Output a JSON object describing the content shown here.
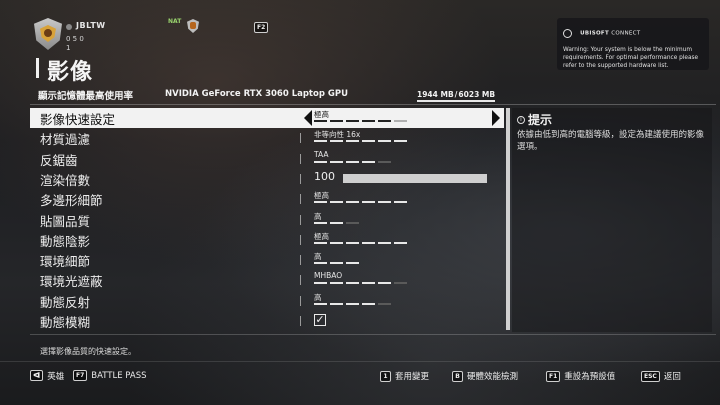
{
  "player": {
    "name": "JBLTW",
    "stats": "0 5 0",
    "rank": "1"
  },
  "header_extra": {
    "nat_label": "NAT",
    "f2_key": "F2"
  },
  "ubisoft": {
    "brand": "UBISOFT",
    "suffix": "CONNECT",
    "message": "Warning: Your system is below the minimum requirements. For optimal performance please refer to the supported hardware list."
  },
  "page": {
    "title": "影像"
  },
  "vram": {
    "label": "顯示記憶體最高使用率",
    "gpu": "NVIDIA GeForce RTX 3060 Laptop GPU",
    "used": "1944 MB",
    "total": "6023 MB",
    "used_fraction": 0.32
  },
  "settings": [
    {
      "label": "影像快速設定",
      "value": "極高",
      "level": 5,
      "total": 6,
      "selected": true
    },
    {
      "label": "材質過濾",
      "value": "非等向性 16x",
      "level": 6,
      "total": 6
    },
    {
      "label": "反鋸齒",
      "value": "TAA",
      "level": 4,
      "total": 5
    },
    {
      "label": "渲染倍數",
      "value": "100",
      "type": "slider",
      "fraction": 1.0
    },
    {
      "label": "多邊形細節",
      "value": "極高",
      "level": 6,
      "total": 6
    },
    {
      "label": "貼圖品質",
      "value": "高",
      "level": 2,
      "total": 3
    },
    {
      "label": "動態陰影",
      "value": "極高",
      "level": 6,
      "total": 6
    },
    {
      "label": "環境細節",
      "value": "高",
      "level": 3,
      "total": 3
    },
    {
      "label": "環境光遮蔽",
      "value": "MHBAO",
      "level": 5,
      "total": 6
    },
    {
      "label": "動態反射",
      "value": "高",
      "level": 4,
      "total": 5
    },
    {
      "label": "動態模糊",
      "type": "checkbox",
      "checked": true,
      "check_glyph": "✓"
    }
  ],
  "hint": {
    "icon": "i",
    "title": "提示",
    "text": "依據由低到高的電腦等級，設定為建議使用的影像選項。"
  },
  "description": "選擇影像品質的快速設定。",
  "footer": {
    "hero": {
      "key": "ᐊ",
      "label": "英雄"
    },
    "battle_pass": {
      "key": "F7",
      "label": "BATTLE PASS"
    },
    "apply": {
      "key": "1",
      "label": "套用變更"
    },
    "benchmark": {
      "key": "B",
      "label": "硬體效能檢測"
    },
    "reset": {
      "key": "F1",
      "label": "重設為預設值"
    },
    "back": {
      "key": "ESC",
      "label": "返回"
    }
  }
}
